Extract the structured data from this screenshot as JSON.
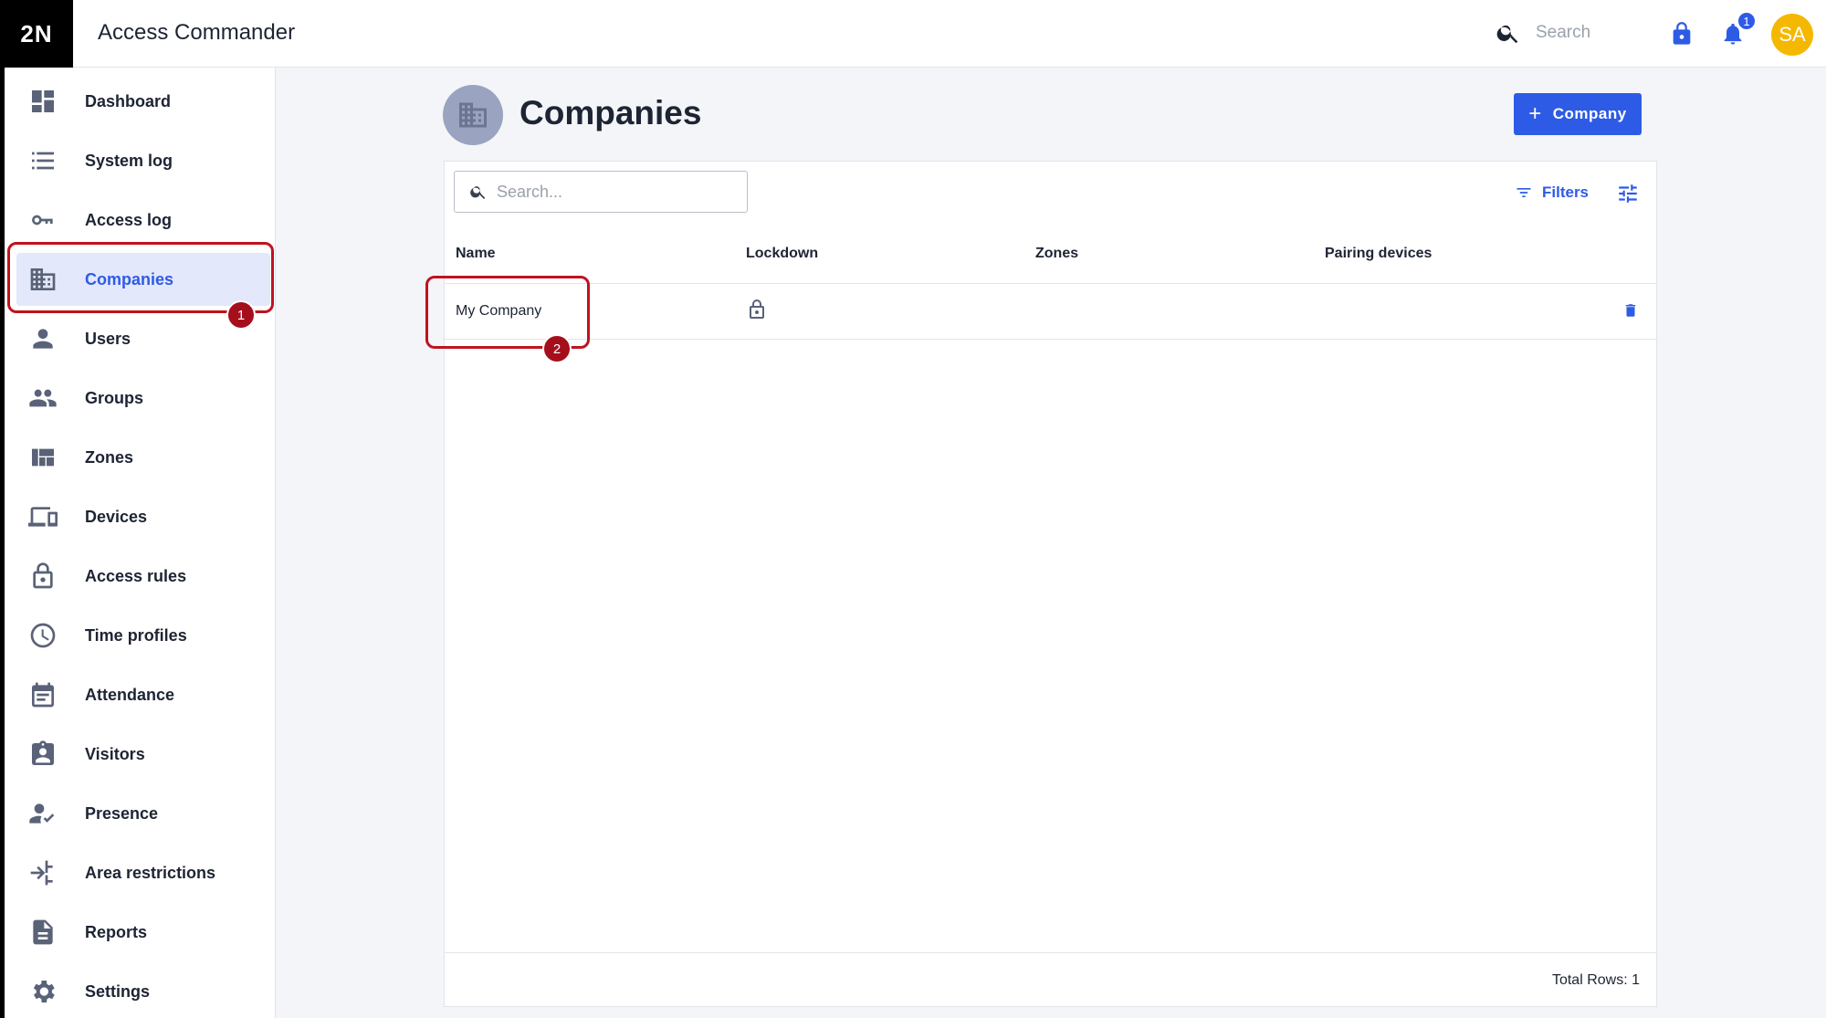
{
  "app": {
    "logo": "2N",
    "title": "Access Commander"
  },
  "topbar": {
    "search_placeholder": "Search",
    "notification_count": "1",
    "avatar_initials": "SA",
    "icons": [
      "search-icon",
      "lock-icon",
      "bell-icon"
    ]
  },
  "sidebar": {
    "items": [
      {
        "label": "Dashboard",
        "icon": "dashboard-icon"
      },
      {
        "label": "System log",
        "icon": "list-icon"
      },
      {
        "label": "Access log",
        "icon": "key-icon"
      },
      {
        "label": "Companies",
        "icon": "building-icon",
        "active": true
      },
      {
        "label": "Users",
        "icon": "person-icon"
      },
      {
        "label": "Groups",
        "icon": "people-icon"
      },
      {
        "label": "Zones",
        "icon": "zones-icon"
      },
      {
        "label": "Devices",
        "icon": "devices-icon"
      },
      {
        "label": "Access rules",
        "icon": "lock-open-icon"
      },
      {
        "label": "Time profiles",
        "icon": "clock-icon"
      },
      {
        "label": "Attendance",
        "icon": "calendar-icon"
      },
      {
        "label": "Visitors",
        "icon": "visitor-badge-icon"
      },
      {
        "label": "Presence",
        "icon": "person-check-icon"
      },
      {
        "label": "Area restrictions",
        "icon": "area-restriction-icon"
      },
      {
        "label": "Reports",
        "icon": "document-icon"
      },
      {
        "label": "Settings",
        "icon": "gear-icon"
      }
    ]
  },
  "annotations": {
    "step1": "1",
    "step2": "2"
  },
  "main": {
    "title": "Companies",
    "add_button_label": "Company",
    "search_placeholder": "Search...",
    "filters_label": "Filters",
    "columns": [
      "Name",
      "Lockdown",
      "Zones",
      "Pairing devices"
    ],
    "rows": [
      {
        "name": "My Company",
        "lockdown": "unlocked",
        "zones": "",
        "pairing_devices": ""
      }
    ],
    "total_rows": "Total Rows: 1"
  },
  "colors": {
    "accent": "#2e5be6",
    "highlight": "#c1121f",
    "avatar": "#f5b800"
  }
}
